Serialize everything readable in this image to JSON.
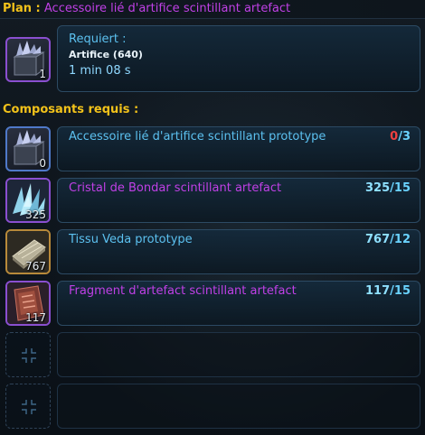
{
  "plan": {
    "prefix": "Plan :",
    "name": "Accessoire lié d'artifice scintillant artefact",
    "icon": "crystal-box-icon",
    "count": "1"
  },
  "requirement": {
    "label": "Requiert :",
    "skill": "Artifice (640)",
    "time": "1 min 08 s"
  },
  "components_label": "Composants requis :",
  "components": [
    {
      "name": "Accessoire lié d'artifice scintillant prototype",
      "have": "0",
      "need": "/3",
      "count": "0",
      "icon": "crystal-box-icon",
      "name_color": "#5cc1f0"
    },
    {
      "name": "Cristal de Bondar scintillant artefact",
      "have": "325",
      "need": "/15",
      "count": "325",
      "icon": "crystal-shards-icon",
      "name_color": "#c040e6"
    },
    {
      "name": "Tissu Veda prototype",
      "have": "767",
      "need": "/12",
      "count": "767",
      "icon": "fabric-icon",
      "name_color": "#5cc1f0"
    },
    {
      "name": "Fragment d'artefact scintillant artefact",
      "have": "117",
      "need": "/15",
      "count": "117",
      "icon": "artifact-fragment-icon",
      "name_color": "#c040e6"
    }
  ],
  "empty_slots": [
    {
      "icon": "empty-slot-crosshair-icon"
    },
    {
      "icon": "empty-slot-crosshair-icon"
    }
  ]
}
